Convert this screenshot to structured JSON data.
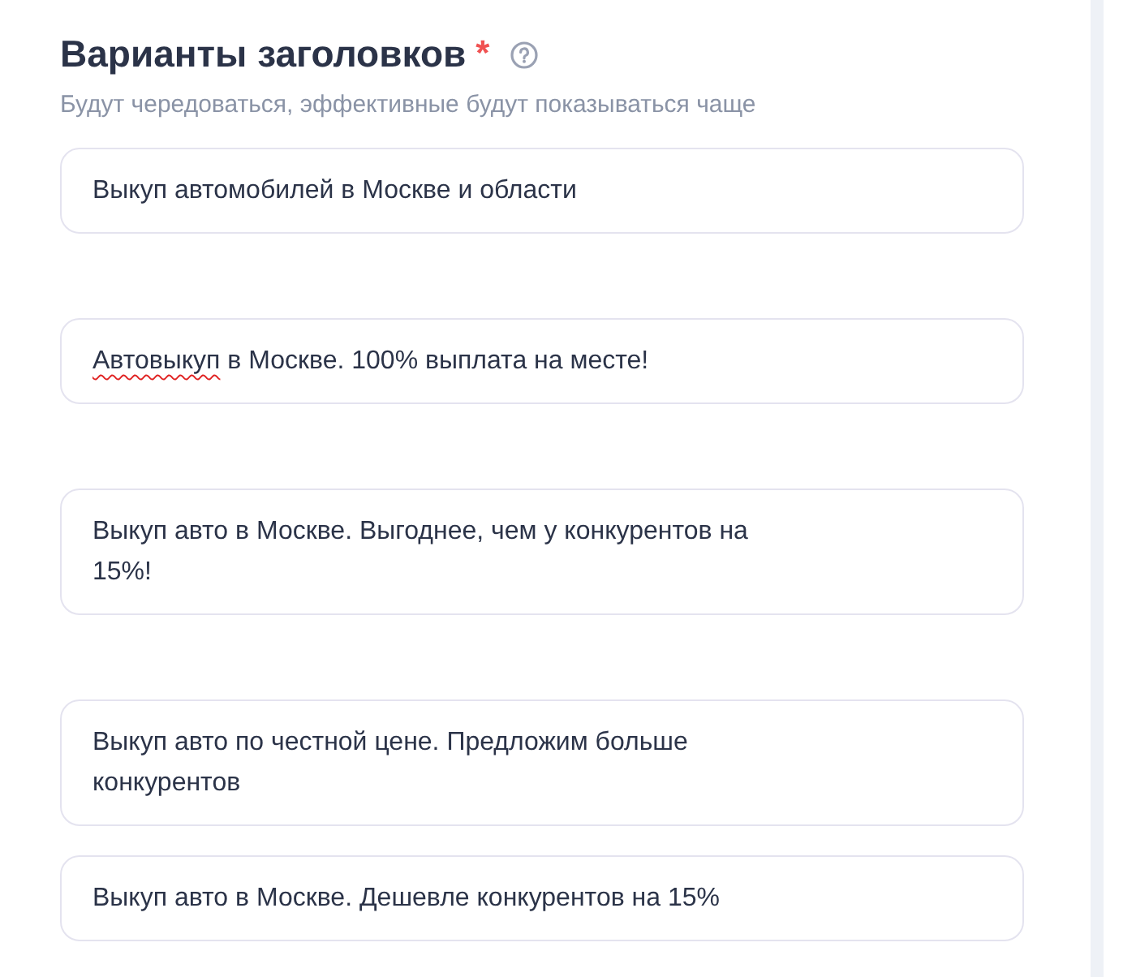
{
  "section": {
    "title": "Варианты заголовков",
    "required_mark": "*",
    "hint": "Будут чередоваться, эффективные будут показываться чаще"
  },
  "headlines": [
    {
      "value": "Выкуп автомобилей в Москве и области",
      "spellcheck_error": false
    },
    {
      "value": "Автовыкуп в Москве. 100% выплата на месте!",
      "spellcheck_error": true
    },
    {
      "value": "Выкуп авто в Москве. Выгоднее, чем у конкурентов на 15%!",
      "spellcheck_error": false
    },
    {
      "value": "Выкуп авто по честной цене. Предложим больше конкурентов",
      "spellcheck_error": false
    },
    {
      "value": "Выкуп авто в Москве. Дешевле конкурентов на 15%",
      "spellcheck_error": false
    }
  ]
}
